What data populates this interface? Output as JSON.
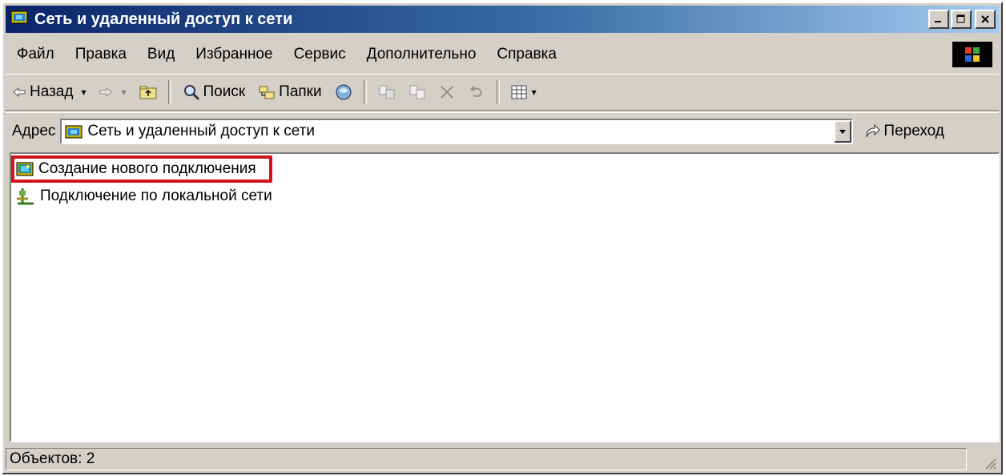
{
  "window": {
    "title": "Сеть и удаленный доступ к сети",
    "controls": [
      "minimize",
      "maximize",
      "close"
    ]
  },
  "menubar": {
    "items": [
      "Файл",
      "Правка",
      "Вид",
      "Избранное",
      "Сервис",
      "Дополнительно",
      "Справка"
    ]
  },
  "toolbar": {
    "back_label": "Назад",
    "search_label": "Поиск",
    "folders_label": "Папки"
  },
  "address": {
    "label": "Адрес",
    "value": "Сеть и удаленный доступ к сети",
    "go_label": "Переход"
  },
  "items": [
    {
      "label": "Создание нового подключения",
      "icon": "new-connection-icon",
      "highlighted": true
    },
    {
      "label": "Подключение по локальной сети",
      "icon": "lan-connection-icon",
      "highlighted": false
    }
  ],
  "status": {
    "text": "Объектов: 2"
  },
  "colors": {
    "highlight_border": "#d3141b",
    "title_gradient_start": "#0a246a",
    "title_gradient_end": "#a6caf0"
  }
}
